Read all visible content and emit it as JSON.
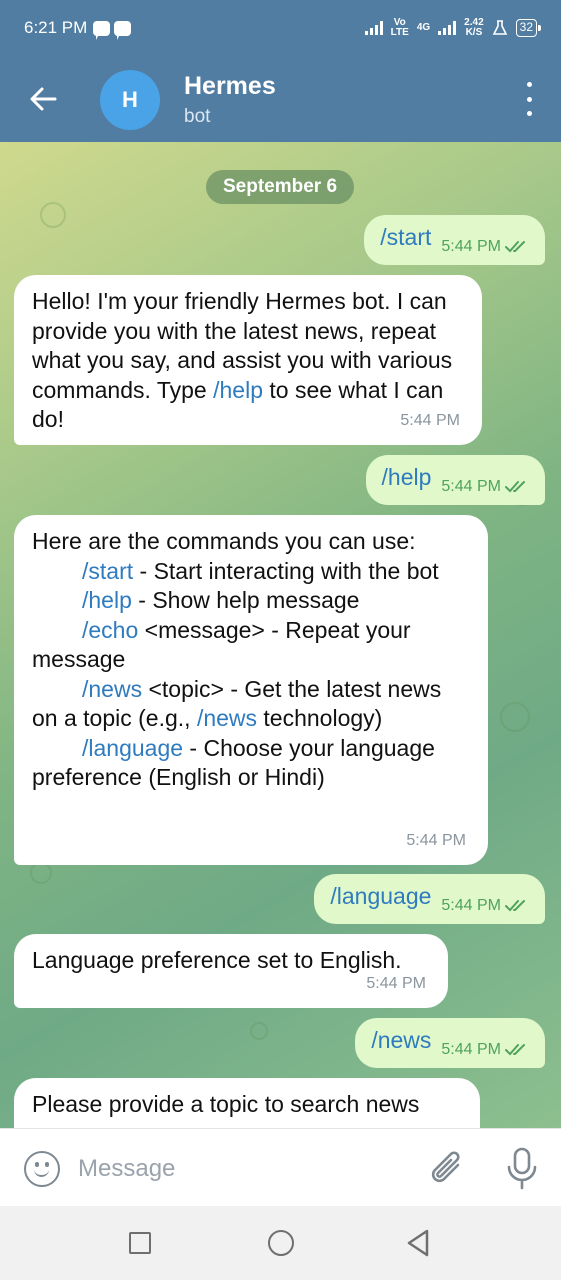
{
  "status_bar": {
    "time": "6:21 PM",
    "network_labels": [
      "Vo",
      "LTE",
      "4G",
      "2.42",
      "K/S"
    ],
    "battery": "32"
  },
  "header": {
    "avatar_letter": "H",
    "title": "Hermes",
    "subtitle": "bot",
    "icons": [
      "back-arrow-icon",
      "more-vert-icon"
    ]
  },
  "chat": {
    "date": "September 6",
    "messages": [
      {
        "dir": "out",
        "text": "/start",
        "time": "5:44 PM"
      },
      {
        "dir": "in",
        "parts": [
          "Hello! I'm your friendly Hermes bot. I can provide you with the latest news, repeat what you say, and assist you with various commands. Type ",
          "/help",
          " to see what I can do!"
        ],
        "time": "5:44 PM"
      },
      {
        "dir": "out",
        "text": "/help",
        "time": "5:44 PM"
      },
      {
        "dir": "in",
        "intro": "Here are the commands you can use:",
        "commands": [
          {
            "cmd": "/start",
            "desc": " - Start interacting with the bot"
          },
          {
            "cmd": "/help",
            "desc": " - Show help message"
          },
          {
            "cmd": "/echo",
            "desc": " <message> - Repeat your message"
          },
          {
            "cmd": "/news",
            "desc": " <topic> - Get the latest news on a topic (e.g., ",
            "cmd2": "/news",
            "desc2": " technology)"
          },
          {
            "cmd": "/language",
            "desc": " - Choose your language preference (English or Hindi)"
          }
        ],
        "time": "5:44 PM"
      },
      {
        "dir": "out",
        "text": "/language",
        "time": "5:44 PM"
      },
      {
        "dir": "in",
        "text": "Language preference set to English.",
        "time": "5:44 PM"
      },
      {
        "dir": "out",
        "text": "/news",
        "time": "5:44 PM"
      },
      {
        "dir": "in",
        "text": "Please provide a topic to search news"
      }
    ]
  },
  "composer": {
    "placeholder": "Message",
    "icons": [
      "emoji-icon",
      "attach-icon",
      "mic-icon"
    ]
  },
  "nav": {
    "icons": [
      "recents-icon",
      "home-icon",
      "back-icon"
    ]
  },
  "colors": {
    "header": "#517da2",
    "outgoing_bubble": "#e1f8ca",
    "command_link": "#2f7bbf",
    "read_check": "#4fa35b"
  }
}
